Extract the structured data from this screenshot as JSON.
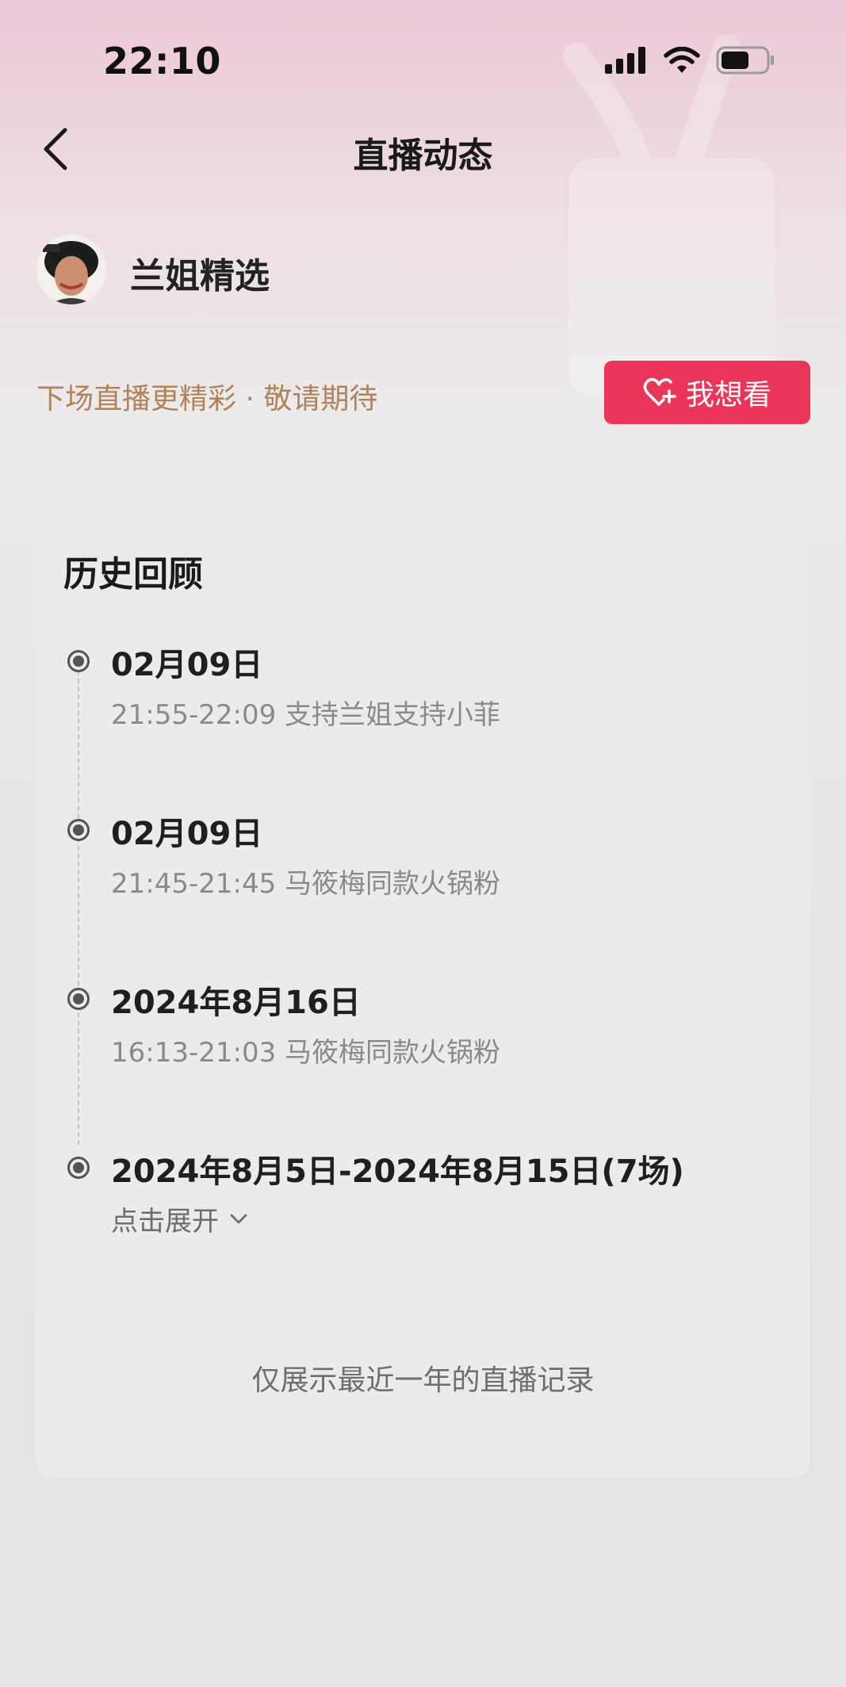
{
  "status_bar": {
    "time": "22:10"
  },
  "nav": {
    "title": "直播动态",
    "back_icon": "chevron-left-icon"
  },
  "anchor": {
    "name": "兰姐精选",
    "avatar_icon": "avatar-photo"
  },
  "notice": {
    "text": "下场直播更精彩 · 敬请期待",
    "button_label": "我想看",
    "button_icon": "heart-plus-icon",
    "accent_color": "#ec3659",
    "notice_color": "#b0835a"
  },
  "history": {
    "title": "历史回顾",
    "items": [
      {
        "date": "02月09日",
        "detail": "21:55-22:09 支持兰姐支持小菲"
      },
      {
        "date": "02月09日",
        "detail": "21:45-21:45 马筱梅同款火锅粉"
      },
      {
        "date": "2024年8月16日",
        "detail": "16:13-21:03 马筱梅同款火锅粉"
      },
      {
        "date": "2024年8月5日-2024年8月15日(7场)",
        "expand_label": "点击展开"
      }
    ],
    "footer": "仅展示最近一年的直播记录"
  }
}
